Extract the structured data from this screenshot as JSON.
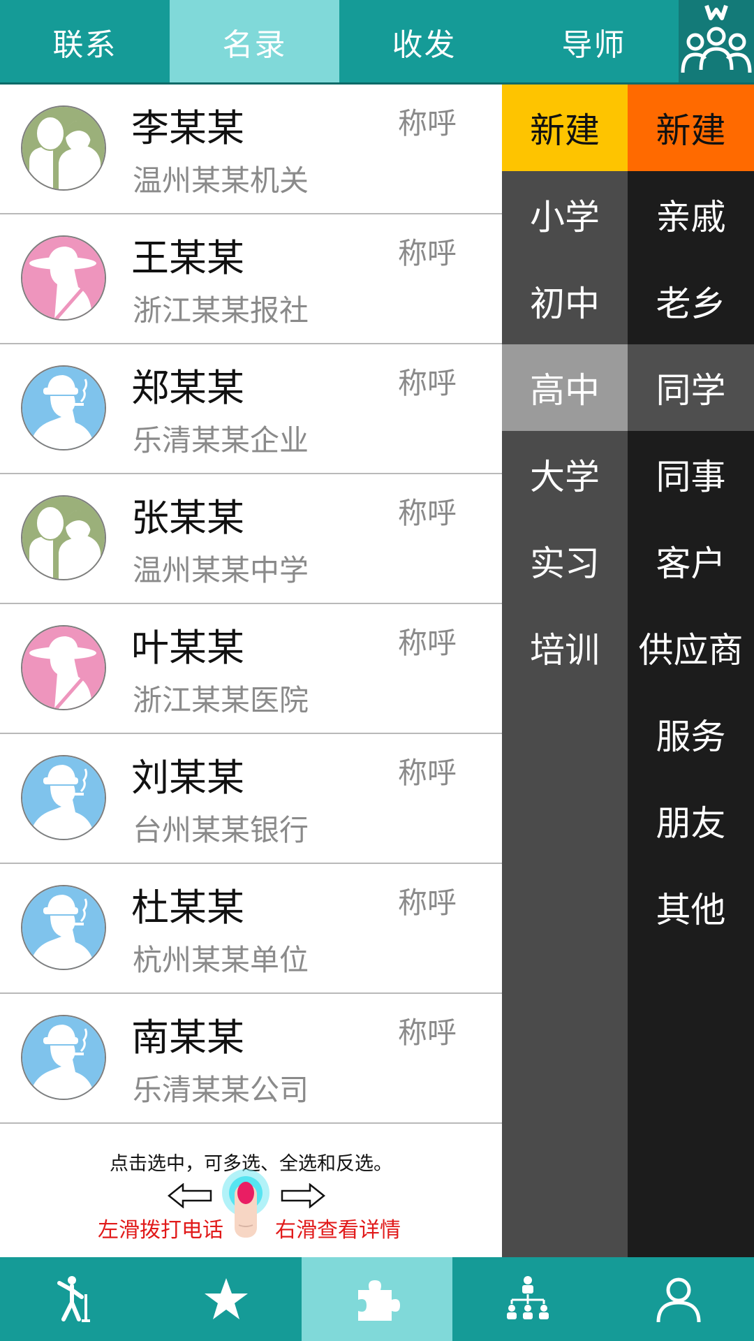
{
  "top_tabs": [
    {
      "label": "联系"
    },
    {
      "label": "名录",
      "active": true
    },
    {
      "label": "收发"
    },
    {
      "label": "导师"
    }
  ],
  "logo_icon": "people-group-logo-icon",
  "contacts": [
    {
      "name": "李某某",
      "org": "温州某某机关",
      "appellation": "称呼",
      "avatar": "couple-avatar-icon"
    },
    {
      "name": "王某某",
      "org": "浙江某某报社",
      "appellation": "称呼",
      "avatar": "woman-hat-avatar-icon"
    },
    {
      "name": "郑某某",
      "org": "乐清某某企业",
      "appellation": "称呼",
      "avatar": "man-hat-avatar-icon"
    },
    {
      "name": "张某某",
      "org": "温州某某中学",
      "appellation": "称呼",
      "avatar": "couple-avatar-icon"
    },
    {
      "name": "叶某某",
      "org": "浙江某某医院",
      "appellation": "称呼",
      "avatar": "woman-hat-avatar-icon"
    },
    {
      "name": "刘某某",
      "org": "台州某某银行",
      "appellation": "称呼",
      "avatar": "man-hat-avatar-icon"
    },
    {
      "name": "杜某某",
      "org": "杭州某某单位",
      "appellation": "称呼",
      "avatar": "man-hat-avatar-icon"
    },
    {
      "name": "南某某",
      "org": "乐清某某公司",
      "appellation": "称呼",
      "avatar": "man-hat-avatar-icon"
    }
  ],
  "hint": {
    "text": "点击选中，可多选、全选和反选。",
    "left": "左滑拨打电话",
    "right": "右滑查看详情"
  },
  "category_col1": [
    "新建",
    "小学",
    "初中",
    "高中",
    "大学",
    "实习",
    "培训"
  ],
  "category_col2": [
    "新建",
    "亲戚",
    "老乡",
    "同学",
    "同事",
    "客户",
    "供应商",
    "服务",
    "朋友",
    "其他"
  ],
  "selected_category": {
    "col1": "高中",
    "col2": "同学"
  },
  "colors": {
    "primary": "#159b97",
    "active_tab": "#80d9d9",
    "new_yellow": "#fec400",
    "new_orange": "#ff6a00",
    "hint_red": "#e11a1a"
  },
  "bottom_nav": [
    {
      "icon": "dancer-icon"
    },
    {
      "icon": "star-icon"
    },
    {
      "icon": "puzzle-icon",
      "active": true
    },
    {
      "icon": "org-chart-icon"
    },
    {
      "icon": "user-icon"
    }
  ]
}
